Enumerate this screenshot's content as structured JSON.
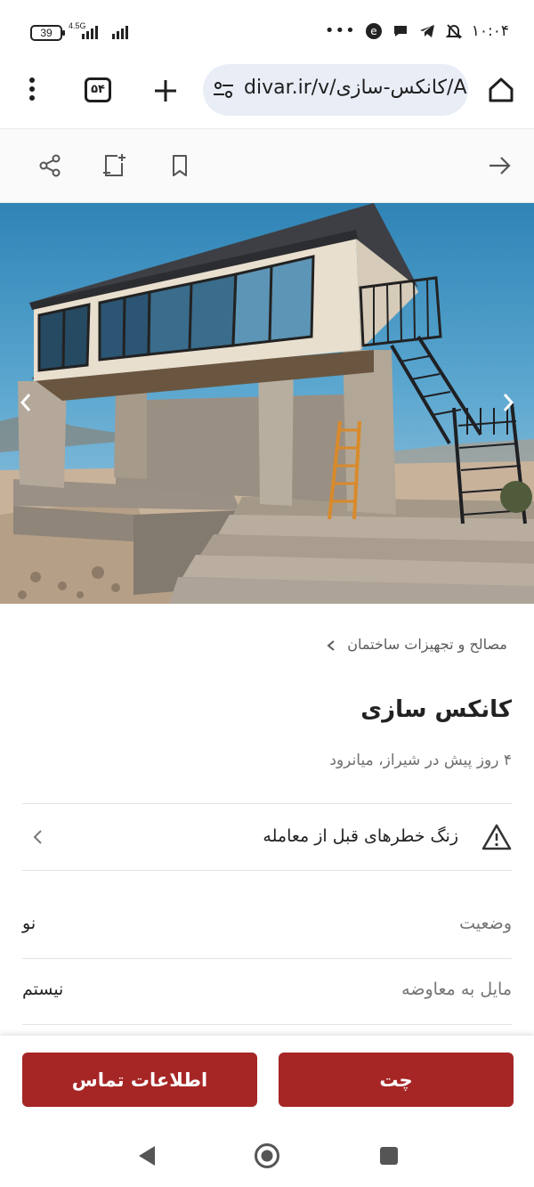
{
  "status_bar": {
    "battery": "39",
    "network": "4.5G",
    "time": "۱۰:۰۴",
    "more": "•••"
  },
  "browser": {
    "tab_count": "۵۴",
    "url": "divar.ir/v/کانکس-سازی/A"
  },
  "listing": {
    "breadcrumb": "مصالح و تجهیزات ساختمان",
    "title": "کانکس سازی",
    "meta": "۴ روز پیش در شیراز، میانرود",
    "warning": "زنگ خطرهای قبل از معامله",
    "attributes": [
      {
        "label": "وضعیت",
        "value": "نو"
      },
      {
        "label": "مایل به معاوضه",
        "value": "نیستم"
      }
    ]
  },
  "actions": {
    "chat": "چت",
    "contact": "اطلاعات تماس"
  },
  "colors": {
    "accent": "#a62626",
    "url_pill": "#e8edf6",
    "text_primary": "#222222",
    "text_secondary": "#757575"
  }
}
